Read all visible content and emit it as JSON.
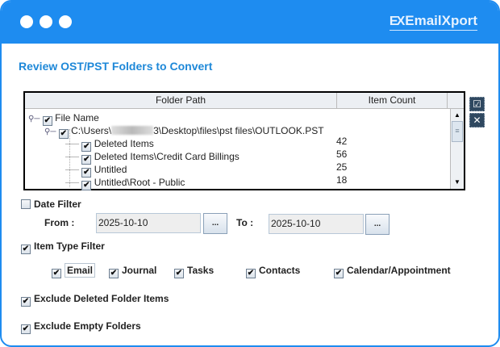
{
  "window": {
    "brand": "EmailXport",
    "brand_mark": "EX",
    "accent": "#1e8cf0"
  },
  "page_title": "Review OST/PST Folders to Convert",
  "table": {
    "columns": [
      "Folder Path",
      "Item Count"
    ],
    "root": {
      "label": "File Name",
      "checked": true
    },
    "file": {
      "path_prefix": "C:\\Users\\",
      "path_suffix": "3\\Desktop\\files\\pst files\\OUTLOOK.PST",
      "checked": true
    },
    "rows": [
      {
        "name": "Deleted Items",
        "count": "42",
        "checked": true
      },
      {
        "name": "Deleted Items\\Credit Card Billings",
        "count": "56",
        "checked": true
      },
      {
        "name": "Untitled",
        "count": "25",
        "checked": true
      },
      {
        "name": "Untitled\\Root - Public",
        "count": "18",
        "checked": true
      }
    ]
  },
  "side_buttons": {
    "select_all": "☑",
    "deselect_all": "✕"
  },
  "date_filter": {
    "label": "Date Filter",
    "checked": false,
    "from_label": "From :",
    "from_value": "2025-10-10",
    "to_label": "To :",
    "to_value": "2025-10-10",
    "picker_label": "..."
  },
  "item_type_filter": {
    "label": "Item Type Filter",
    "checked": true,
    "types": [
      {
        "label": "Email",
        "checked": true
      },
      {
        "label": "Journal",
        "checked": true
      },
      {
        "label": "Tasks",
        "checked": true
      },
      {
        "label": "Contacts",
        "checked": true
      },
      {
        "label": "Calendar/Appointment",
        "checked": true
      }
    ]
  },
  "exclude_deleted": {
    "label": "Exclude Deleted Folder Items",
    "checked": true
  },
  "exclude_empty": {
    "label": "Exclude Empty Folders",
    "checked": true
  },
  "check_glyph": "✔"
}
